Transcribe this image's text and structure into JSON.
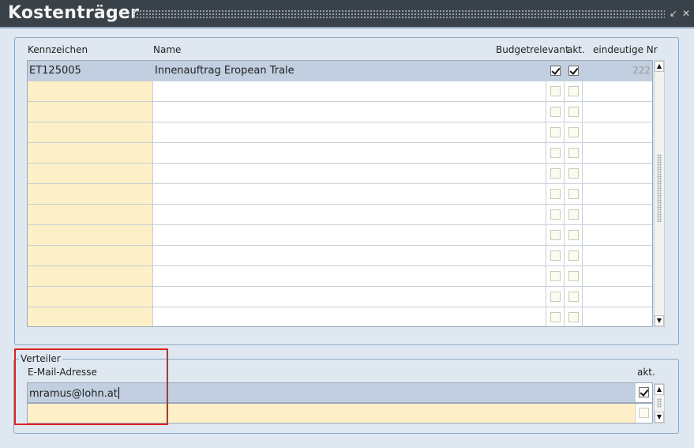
{
  "window": {
    "title": "Kostenträger"
  },
  "kostentraeger": {
    "headers": {
      "kennzeichen": "Kennzeichen",
      "name": "Name",
      "budgetrelevant": "Budgetrelevant",
      "akt": "akt.",
      "eindeutige_nr": "eindeutige Nr"
    },
    "rows": [
      {
        "kennzeichen": "ET125005",
        "name": "Innenauftrag Eropean Trale",
        "budgetrelevant": true,
        "akt": true,
        "nr": "222"
      },
      {
        "kennzeichen": "",
        "name": "",
        "budgetrelevant": false,
        "akt": false,
        "nr": ""
      },
      {
        "kennzeichen": "",
        "name": "",
        "budgetrelevant": false,
        "akt": false,
        "nr": ""
      },
      {
        "kennzeichen": "",
        "name": "",
        "budgetrelevant": false,
        "akt": false,
        "nr": ""
      },
      {
        "kennzeichen": "",
        "name": "",
        "budgetrelevant": false,
        "akt": false,
        "nr": ""
      },
      {
        "kennzeichen": "",
        "name": "",
        "budgetrelevant": false,
        "akt": false,
        "nr": ""
      },
      {
        "kennzeichen": "",
        "name": "",
        "budgetrelevant": false,
        "akt": false,
        "nr": ""
      },
      {
        "kennzeichen": "",
        "name": "",
        "budgetrelevant": false,
        "akt": false,
        "nr": ""
      },
      {
        "kennzeichen": "",
        "name": "",
        "budgetrelevant": false,
        "akt": false,
        "nr": ""
      },
      {
        "kennzeichen": "",
        "name": "",
        "budgetrelevant": false,
        "akt": false,
        "nr": ""
      },
      {
        "kennzeichen": "",
        "name": "",
        "budgetrelevant": false,
        "akt": false,
        "nr": ""
      },
      {
        "kennzeichen": "",
        "name": "",
        "budgetrelevant": false,
        "akt": false,
        "nr": ""
      },
      {
        "kennzeichen": "",
        "name": "",
        "budgetrelevant": false,
        "akt": false,
        "nr": ""
      }
    ]
  },
  "verteiler": {
    "legend": "Verteiler",
    "headers": {
      "email": "E-Mail-Adresse",
      "akt": "akt."
    },
    "rows": [
      {
        "email": "mramus@lohn.at",
        "akt": true
      },
      {
        "email": "",
        "akt": false
      }
    ]
  },
  "icons": {
    "scroll_up": "scroll-up-icon",
    "scroll_down": "scroll-down-icon",
    "minimize": "minimize-icon",
    "close": "close-icon"
  },
  "colors": {
    "titlebar": "#3a4249",
    "selected_row": "#c1cfe0",
    "required_field": "#fdefc7",
    "highlight_box": "#e02020"
  }
}
